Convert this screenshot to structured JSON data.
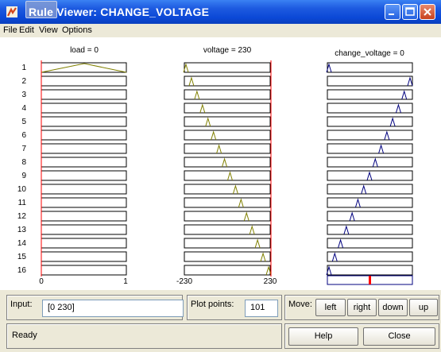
{
  "window": {
    "title": "Rule Viewer: CHANGE_VOLTAGE",
    "title_color": "#0b48d6"
  },
  "menu": [
    "File",
    "Edit",
    "View",
    "Options"
  ],
  "rule_numbers": [
    "1",
    "2",
    "3",
    "4",
    "5",
    "6",
    "7",
    "8",
    "9",
    "10",
    "11",
    "12",
    "13",
    "14",
    "15",
    "16"
  ],
  "inputs": [
    {
      "label": "load = 0",
      "axis_min": "0",
      "axis_max": "1",
      "color": "#808000"
    },
    {
      "label": "voltage = 230",
      "axis_min": "-230",
      "axis_max": "230",
      "color": "#808000"
    }
  ],
  "output": {
    "label": "change_voltage = 0",
    "color": "#00007f"
  },
  "indicator_color": "#ff0000",
  "controls": {
    "input_label": "Input:",
    "input_value": "[0 230]",
    "plot_points_label": "Plot points:",
    "plot_points_value": "101",
    "move_label": "Move:",
    "move_buttons": [
      "left",
      "right",
      "down",
      "up"
    ],
    "status": "Ready",
    "help_label": "Help",
    "close_label": "Close"
  }
}
